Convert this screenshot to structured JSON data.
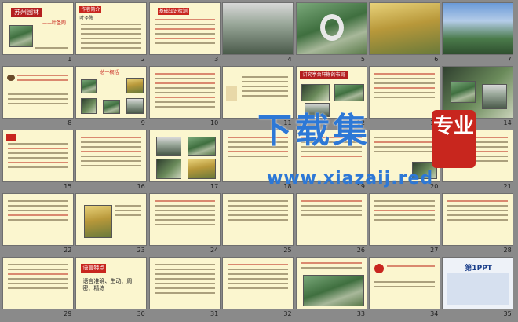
{
  "thumbnails": [
    {
      "num": "1",
      "title": "苏州园林",
      "subtitle": "——叶圣陶",
      "style": "paper"
    },
    {
      "num": "2",
      "title": "作者简介",
      "subtitle": "叶圣陶",
      "style": "paper"
    },
    {
      "num": "3",
      "title": "基础知识检测",
      "subtitle": "",
      "style": "paper"
    },
    {
      "num": "4",
      "title": "",
      "subtitle": "",
      "style": "photo-gray"
    },
    {
      "num": "5",
      "title": "",
      "subtitle": "",
      "style": "photo-green"
    },
    {
      "num": "6",
      "title": "",
      "subtitle": "",
      "style": "photo-gold"
    },
    {
      "num": "7",
      "title": "",
      "subtitle": "",
      "style": "photo-blue"
    },
    {
      "num": "8",
      "title": "",
      "subtitle": "",
      "style": "paper"
    },
    {
      "num": "9",
      "title": "总一概括",
      "subtitle": "",
      "style": "paper"
    },
    {
      "num": "10",
      "title": "",
      "subtitle": "",
      "style": "paper"
    },
    {
      "num": "11",
      "title": "讲究亭台轩榭的布局",
      "subtitle": "",
      "style": "paper"
    },
    {
      "num": "12",
      "title": "",
      "subtitle": "",
      "style": "paper"
    },
    {
      "num": "13",
      "title": "",
      "subtitle": "",
      "style": "photo-green"
    },
    {
      "num": "14",
      "title": "",
      "subtitle": "",
      "style": "paper"
    },
    {
      "num": "15",
      "title": "",
      "subtitle": "",
      "style": "paper"
    },
    {
      "num": "16",
      "title": "",
      "subtitle": "",
      "style": "paper"
    },
    {
      "num": "17",
      "title": "",
      "subtitle": "",
      "style": "paper"
    },
    {
      "num": "18",
      "title": "",
      "subtitle": "",
      "style": "paper"
    },
    {
      "num": "19",
      "title": "",
      "subtitle": "",
      "style": "paper"
    },
    {
      "num": "20",
      "title": "",
      "subtitle": "",
      "style": "paper"
    },
    {
      "num": "21",
      "title": "",
      "subtitle": "",
      "style": "paper"
    },
    {
      "num": "22",
      "title": "",
      "subtitle": "",
      "style": "paper"
    },
    {
      "num": "23",
      "title": "",
      "subtitle": "",
      "style": "paper"
    },
    {
      "num": "24",
      "title": "",
      "subtitle": "",
      "style": "paper"
    },
    {
      "num": "25",
      "title": "",
      "subtitle": "",
      "style": "paper"
    },
    {
      "num": "26",
      "title": "",
      "subtitle": "",
      "style": "paper"
    },
    {
      "num": "27",
      "title": "",
      "subtitle": "",
      "style": "paper"
    },
    {
      "num": "28",
      "title": "",
      "subtitle": "",
      "style": "paper"
    },
    {
      "num": "29",
      "title": "",
      "subtitle": "",
      "style": "paper"
    },
    {
      "num": "30",
      "title": "语言特点",
      "subtitle": "语言准确、生动、周密、精练",
      "style": "paper"
    },
    {
      "num": "31",
      "title": "",
      "subtitle": "",
      "style": "paper"
    },
    {
      "num": "32",
      "title": "",
      "subtitle": "",
      "style": "paper"
    },
    {
      "num": "33",
      "title": "",
      "subtitle": "",
      "style": "paper"
    },
    {
      "num": "34",
      "title": "",
      "subtitle": "",
      "style": "paper"
    },
    {
      "num": "35",
      "title": "第1PPT",
      "subtitle": "",
      "style": "logo"
    }
  ],
  "watermark": {
    "title": "下载集",
    "url": "www.xiazaij.red",
    "seal": "专业"
  },
  "colors": {
    "accent": "#c8261e",
    "watermark": "#2d78d6",
    "background": "#8a8a8a",
    "paper": "#fbf6cf"
  }
}
